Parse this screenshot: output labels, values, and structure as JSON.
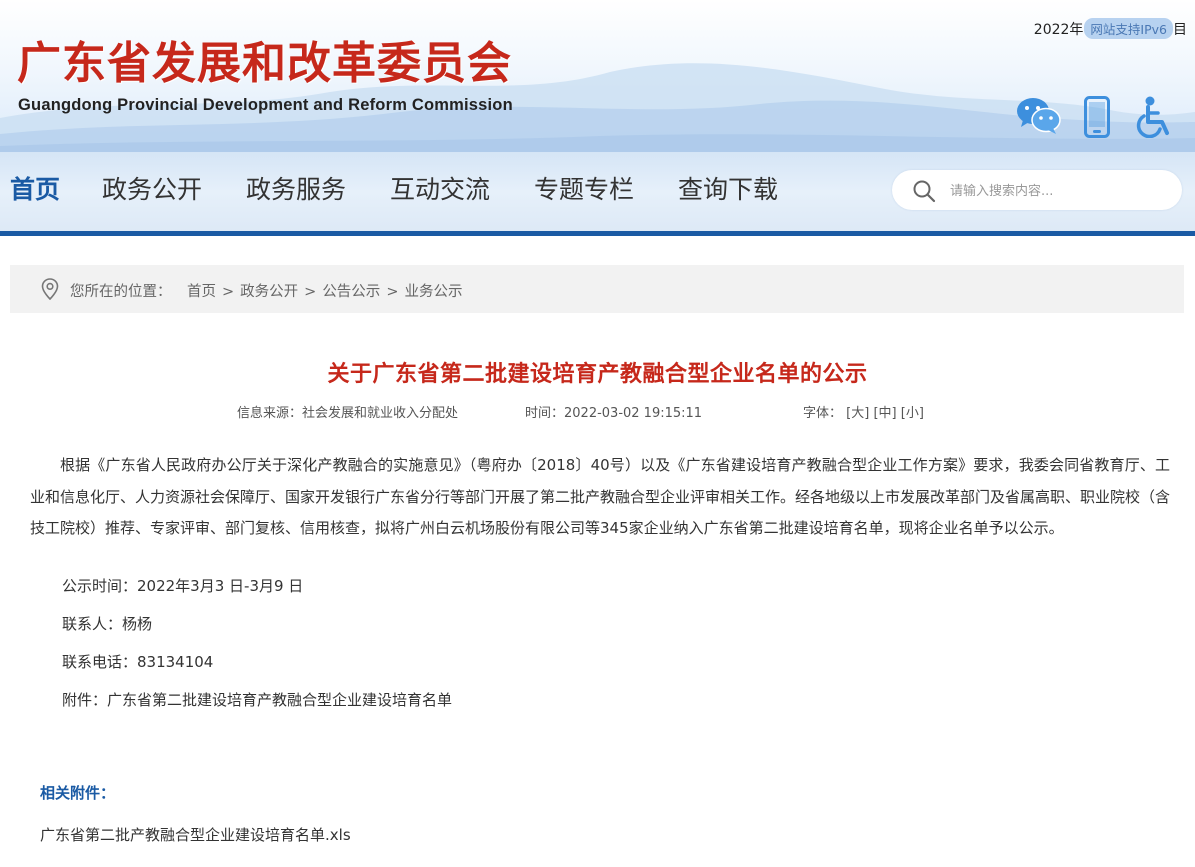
{
  "header": {
    "top_note": "2022年",
    "ipv6_badge": "网站支持IPv6",
    "top_note_tail": "目",
    "site_title": "广东省发展和改革委员会",
    "site_subtitle": "Guangdong Provincial Development and Reform Commission",
    "icons": [
      "wechat-icon",
      "mobile-icon",
      "accessibility-icon"
    ]
  },
  "nav": {
    "items": [
      {
        "label": "首页",
        "active": true
      },
      {
        "label": "政务公开"
      },
      {
        "label": "政务服务"
      },
      {
        "label": "互动交流"
      },
      {
        "label": "专题专栏"
      },
      {
        "label": "查询下载"
      }
    ],
    "search_placeholder": "请输入搜索内容..."
  },
  "breadcrumb": {
    "label": "您所在的位置：",
    "items": [
      "首页",
      "政务公开",
      "公告公示",
      "业务公示"
    ],
    "separator": ">"
  },
  "article": {
    "title": "关于广东省第二批建设培育产教融合型企业名单的公示",
    "source": "信息来源：社会发展和就业收入分配处",
    "time": "时间：2022-03-02 19:15:11",
    "font_size_label": "字体：",
    "font_sizes": [
      "[大]",
      "[中]",
      "[小]"
    ],
    "paragraph": "根据《广东省人民政府办公厅关于深化产教融合的实施意见》（粤府办〔2018〕40号）以及《广东省建设培育产教融合型企业工作方案》要求，我委会同省教育厅、工业和信息化厅、人力资源社会保障厅、国家开发银行广东省分行等部门开展了第二批产教融合型企业评审相关工作。经各地级以上市发展改革部门及省属高职、职业院校（含技工院校）推荐、专家评审、部门复核、信用核查，拟将广州白云机场股份有限公司等345家企业纳入广东省第二批建设培育名单，现将企业名单予以公示。",
    "lines": [
      "公示时间：2022年3月3 日-3月9 日",
      "联系人：杨杨",
      "联系电话：83134104",
      "附件：广东省第二批建设培育产教融合型企业建设培育名单"
    ]
  },
  "attachments": {
    "title": "相关附件：",
    "files": [
      "广东省第二批产教融合型企业建设培育名单.xls"
    ]
  },
  "colors": {
    "brand_red": "#c6281b",
    "brand_blue": "#1a5aa4",
    "icon_blue": "#3d8fdd"
  }
}
